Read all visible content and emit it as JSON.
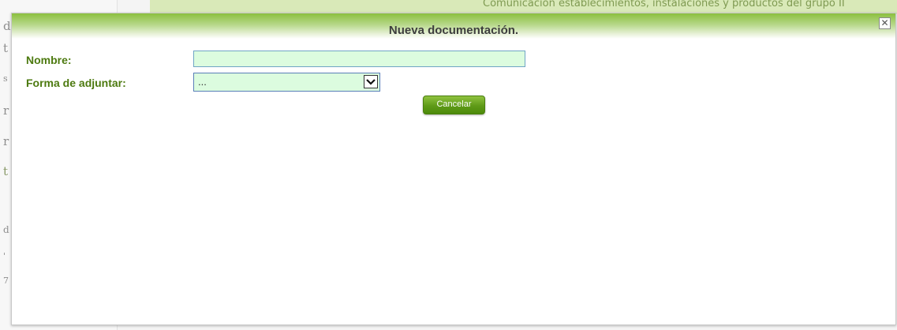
{
  "background": {
    "banner_text": "Comunicación establecimientos, instalaciones y productos del grupo II",
    "left_fragments": [
      "d",
      "t",
      "s",
      "r",
      "r",
      "t",
      "d",
      "'",
      "7"
    ]
  },
  "dialog": {
    "title": "Nueva documentación.",
    "close_glyph": "✕"
  },
  "form": {
    "nombre_label": "Nombre:",
    "nombre_value": "",
    "forma_label": "Forma de adjuntar:",
    "forma_selected": "...",
    "cancel_label": "Cancelar"
  },
  "colors": {
    "label_green": "#4d7a10",
    "field_bg": "#dcfcdf",
    "button_green": "#5f9a18",
    "titlebar_green": "#8cbf3e"
  }
}
